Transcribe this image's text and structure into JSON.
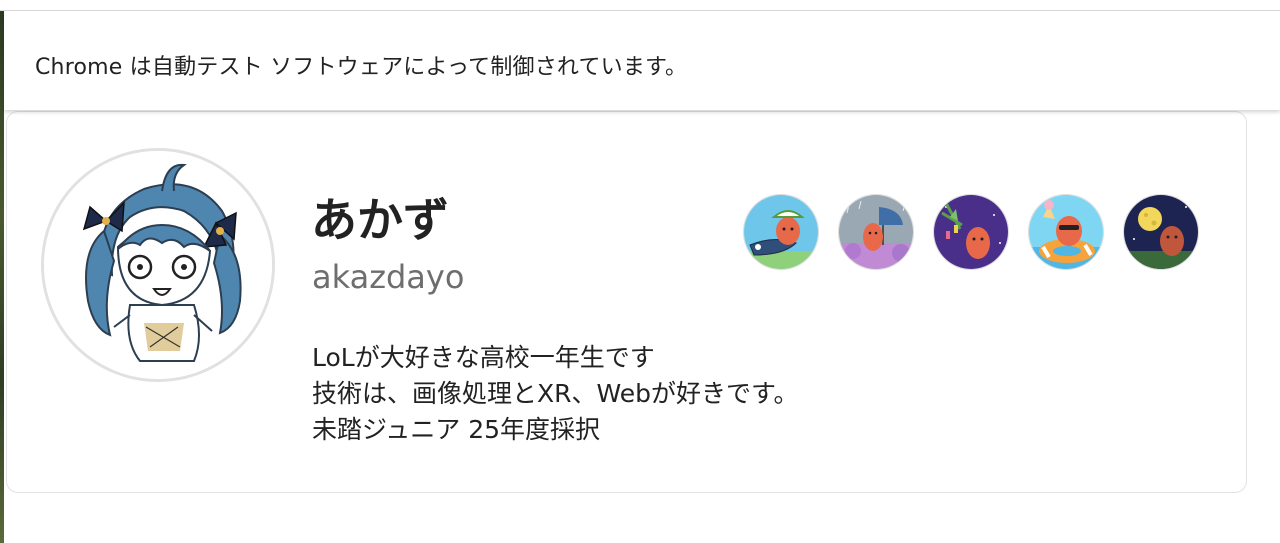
{
  "infobar": {
    "message": "Chrome は自動テスト ソフトウェアによって制御されています。"
  },
  "profile": {
    "display_name": "あかず",
    "username": "akazdayo",
    "bio_lines": [
      "LoLが大好きな高校一年生です",
      "技術は、画像処理とXR、Webが好きです。",
      "未踏ジュニア 25年度採択"
    ]
  },
  "badges": [
    {
      "icon": "carp-streamer-badge-icon"
    },
    {
      "icon": "rainy-hydrangea-badge-icon"
    },
    {
      "icon": "tanabata-badge-icon"
    },
    {
      "icon": "summer-swim-ring-badge-icon"
    },
    {
      "icon": "full-moon-badge-icon"
    }
  ],
  "colors": {
    "text": "#222222",
    "muted": "#6e6e6e",
    "border": "#e3e3e3"
  }
}
